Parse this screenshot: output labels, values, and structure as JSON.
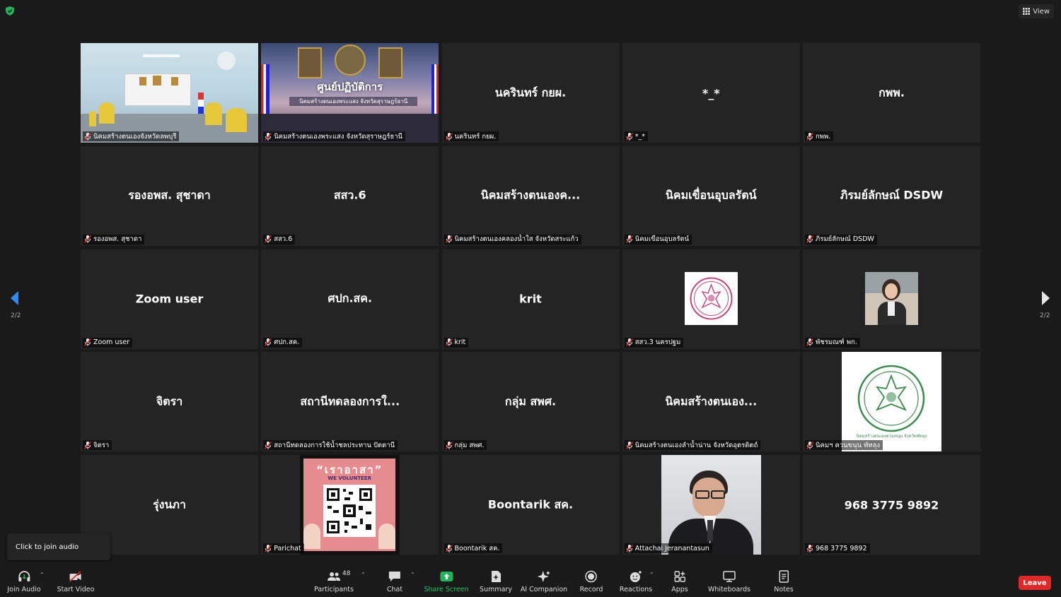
{
  "topbar": {
    "view_label": "View"
  },
  "nav": {
    "page_left": "2/2",
    "page_right": "2/2"
  },
  "tiles": [
    {
      "center": "",
      "label": "นิคมสร้างตนเองจังหวัดลพบุรี"
    },
    {
      "center": "",
      "label": "นิคมสร้างตนเองพระแสง จังหวัดสุราษฎร์ธานี"
    },
    {
      "center": "นครินทร์ กยผ.",
      "label": "นครินทร์ กยผ."
    },
    {
      "center": "*_*",
      "label": "*_*"
    },
    {
      "center": "กพพ.",
      "label": "กพพ."
    },
    {
      "center": "รองอพส. สุชาดา",
      "label": "รองอพส. สุชาดา"
    },
    {
      "center": "สสว.6",
      "label": "สสว.6"
    },
    {
      "center": "นิคมสร้างตนเองค...",
      "label": "นิคมสร้างตนเองคลองน้ำใส จังหวัดสระแก้ว"
    },
    {
      "center": "นิคมเขื่อนอุบลรัตน์",
      "label": "นิคมเขื่อนอุบลรัตน์"
    },
    {
      "center": "ภิรมย์ลักษณ์ DSDW",
      "label": "ภิรมย์ลักษณ์ DSDW"
    },
    {
      "center": "Zoom user",
      "label": "Zoom user"
    },
    {
      "center": "ศปก.สค.",
      "label": "ศปก.สค."
    },
    {
      "center": "krit",
      "label": "krit"
    },
    {
      "center": "",
      "label": "สสว.3 นครปฐม"
    },
    {
      "center": "",
      "label": "พัชรมณฑ์ พก."
    },
    {
      "center": "จิตรา",
      "label": "จิตรา"
    },
    {
      "center": "สถานีทดลองการใ...",
      "label": "สถานีทดลองการใช้น้ำชลประทาน ปัตตานี"
    },
    {
      "center": "กลุ่ม สพศ.",
      "label": "กลุ่ม สพศ."
    },
    {
      "center": "นิคมสร้างตนเอง...",
      "label": "นิคมสร้างตนเองลำน้ำน่าน จังหวัดอุตรดิตถ์"
    },
    {
      "center": "",
      "label": "นิคมฯ ควนขนุน พัทลุง"
    },
    {
      "center": "รุ่งนภา",
      "label": ""
    },
    {
      "center": "",
      "label": "Parichat"
    },
    {
      "center": "Boontarik สค.",
      "label": "Boontarik สค."
    },
    {
      "center": "",
      "label": "Attachai Jeranantasun"
    },
    {
      "center": "968 3775 9892",
      "label": "968 3775 9892"
    }
  ],
  "pictures": {
    "center_sign_title": "ศูนย์ปฏิบัติการ",
    "center_sign_sub": "นิคมสร้างตนเองพระแสง จังหวัดสุราษฎร์ธานี",
    "poster_title": "“เราอาสา”",
    "poster_sub": "WE VOLUNTEER",
    "logo_caption": "นิคมสร้างตนเองควนขนุน จังหวัดพัทลุง"
  },
  "tooltip": {
    "text": "Click to join audio"
  },
  "toolbar": {
    "join_audio": "Join Audio",
    "start_video": "Start Video",
    "participants": "Participants",
    "participants_count": "48",
    "chat": "Chat",
    "share_screen": "Share Screen",
    "summary": "Summary",
    "ai_companion": "AI Companion",
    "record": "Record",
    "reactions": "Reactions",
    "apps": "Apps",
    "whiteboards": "Whiteboards",
    "notes": "Notes",
    "leave": "Leave"
  },
  "colors": {
    "background": "#1a1a1a",
    "tile": "#242424",
    "leave": "#e02828",
    "share": "#22b35a",
    "nav_arrow": "#2d8cff"
  }
}
